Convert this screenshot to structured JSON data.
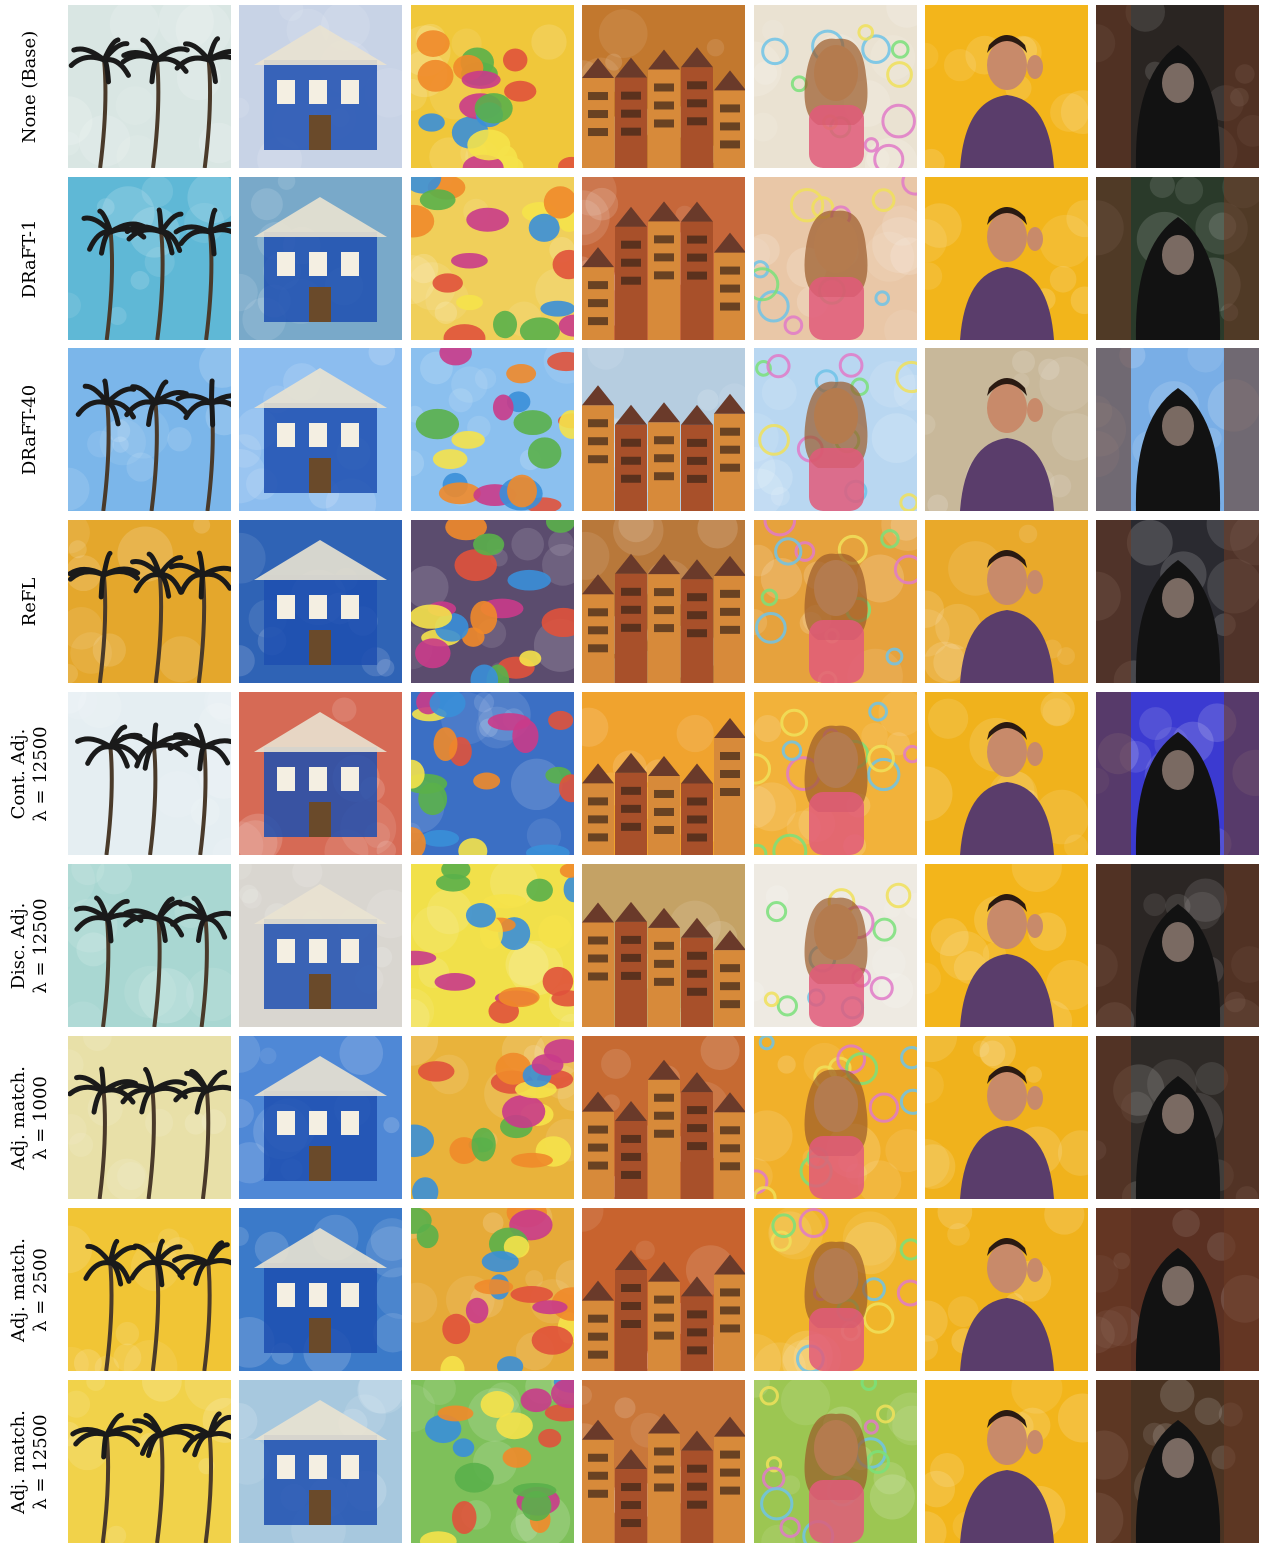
{
  "rows": [
    {
      "label": [
        "None (Base)"
      ]
    },
    {
      "label": [
        "DRaFT-1"
      ]
    },
    {
      "label": [
        "DRaFT-40"
      ]
    },
    {
      "label": [
        "ReFL"
      ]
    },
    {
      "label": [
        "Cont. Adj.",
        "λ = 12500"
      ]
    },
    {
      "label": [
        "Disc. Adj.",
        "λ = 12500"
      ]
    },
    {
      "label": [
        "Adj. match.",
        "λ = 1000"
      ]
    },
    {
      "label": [
        "Adj. match.",
        "λ = 2500"
      ]
    },
    {
      "label": [
        "Adj. match.",
        "λ = 12500"
      ]
    }
  ],
  "columns": [
    {
      "subject": "palm-trees",
      "base": "#cfe6ee",
      "accent": "#1a1a1a",
      "extra": "#f4b13a"
    },
    {
      "subject": "house",
      "base": "#4f8fd6",
      "accent": "#e9e2d0",
      "extra": "#1d4fb0"
    },
    {
      "subject": "fruit",
      "base": "#f2c21e",
      "accent": "#e0523b",
      "extra": "#3a8fd8"
    },
    {
      "subject": "old-town",
      "base": "#c96a2b",
      "accent": "#f1b54a",
      "extra": "#5a3a2a"
    },
    {
      "subject": "girl-with-bubbles",
      "base": "#f0b72a",
      "accent": "#bfe3f3",
      "extra": "#e05a7a"
    },
    {
      "subject": "man-listening",
      "base": "#f3b51b",
      "accent": "#5a3d6b",
      "extra": "#c88a6a"
    },
    {
      "subject": "hooded-figure",
      "base": "#1c1a1a",
      "accent": "#6b3a24",
      "extra": "#c5c5c5"
    }
  ],
  "tile_tints": [
    [
      "#d9e6e3",
      "#c8d3e6",
      "#f0c73a",
      "#c2782e",
      "#eae2d2",
      "#f3b51b",
      "#2a2522"
    ],
    [
      "#5fb8d6",
      "#79a9c9",
      "#f0cf5a",
      "#c6673a",
      "#e9c7a7",
      "#f2b51b",
      "#2a3a2a"
    ],
    [
      "#7bb6ea",
      "#8cbdef",
      "#8bc0ef",
      "#b6cde0",
      "#b9d7f1",
      "#c8b89a",
      "#79aee6"
    ],
    [
      "#e4a72c",
      "#2f63b5",
      "#5b4c6e",
      "#b8783a",
      "#e6a23d",
      "#e9a92a",
      "#2a2a30"
    ],
    [
      "#e5eef2",
      "#d66a55",
      "#3b6fc4",
      "#f0a32e",
      "#f2b23a",
      "#f0b21c",
      "#3b3ad1"
    ],
    [
      "#a9d7d2",
      "#d9d6d0",
      "#f1e04a",
      "#c4a265",
      "#eeeae2",
      "#f3b51b",
      "#2b2624"
    ],
    [
      "#e8e0a8",
      "#4f88d6",
      "#e9b33b",
      "#c66a32",
      "#f1b02a",
      "#f0b21c",
      "#2e2a27"
    ],
    [
      "#f1c535",
      "#3b7ac9",
      "#e6aa38",
      "#c8632e",
      "#f0b52a",
      "#f0b21c",
      "#5a3022"
    ],
    [
      "#f1d24a",
      "#a7c8de",
      "#7ec05a",
      "#c9773a",
      "#9cc652",
      "#f2b51b",
      "#4a3322"
    ]
  ]
}
